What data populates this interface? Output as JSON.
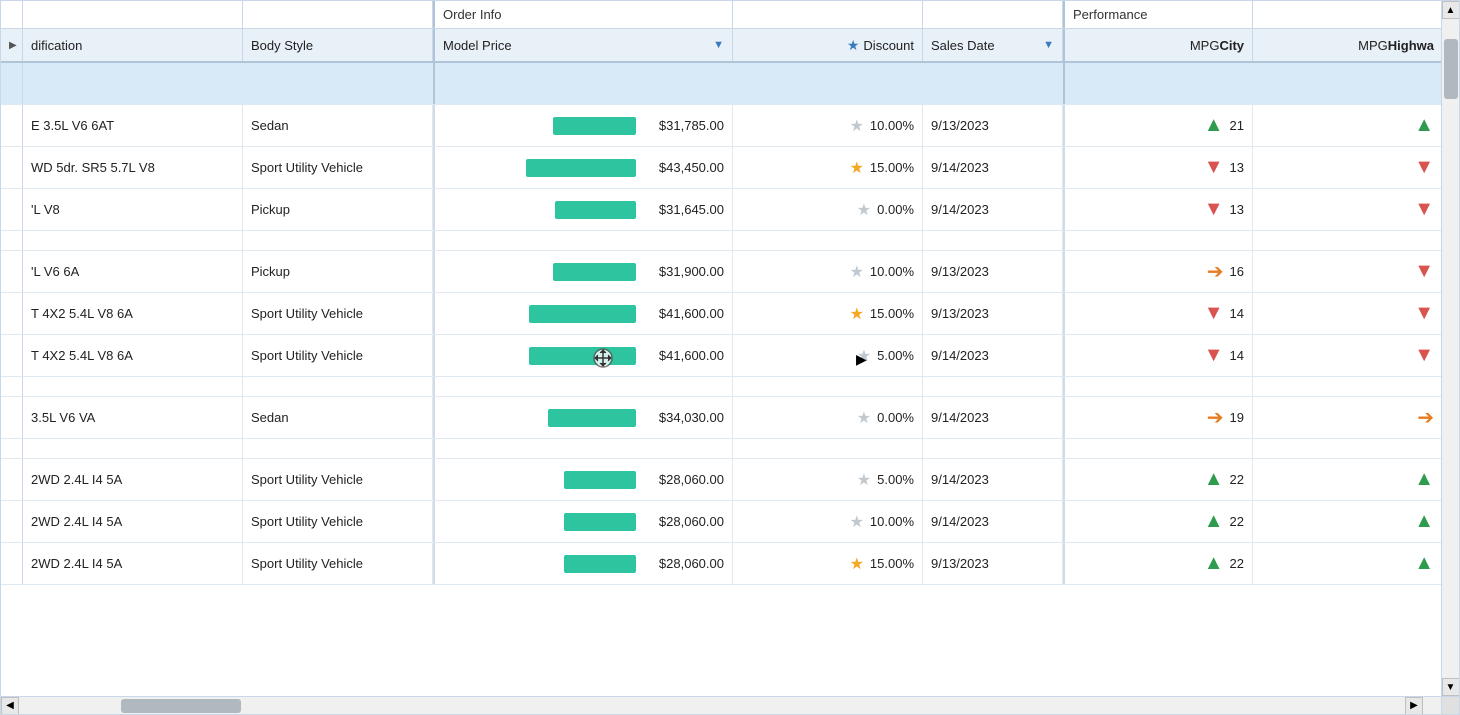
{
  "grid": {
    "group_header": {
      "order_info_label": "Order Info",
      "performance_label": "Performance"
    },
    "columns": [
      {
        "id": "expand",
        "label": ""
      },
      {
        "id": "modification",
        "label": "dification"
      },
      {
        "id": "body_style",
        "label": "Body Style"
      },
      {
        "id": "model_price",
        "label": "Model Price",
        "has_filter": true
      },
      {
        "id": "discount",
        "label": "Discount",
        "has_star": true
      },
      {
        "id": "sales_date",
        "label": "Sales Date",
        "has_filter": true
      },
      {
        "id": "mpg_city",
        "label_prefix": "MPG ",
        "label_bold": "City"
      },
      {
        "id": "mpg_highway",
        "label_prefix": "MPG ",
        "label_bold": "Highwa"
      }
    ],
    "rows": [
      {
        "type": "highlighted",
        "modification": "",
        "body_style": "",
        "price_bar_width": 0,
        "price": "",
        "star_filled": false,
        "discount": "",
        "sales_date": "",
        "mpg_city_arrow": "",
        "mpg_city": "",
        "mpg_highway_arrow": ""
      },
      {
        "type": "data",
        "modification": "E 3.5L V6 6AT",
        "body_style": "Sedan",
        "price_bar_width": 75,
        "price": "$31,785.00",
        "star_filled": false,
        "discount": "10.00%",
        "sales_date": "9/13/2023",
        "mpg_city_arrow": "up-green",
        "mpg_city": "21",
        "mpg_highway_arrow": "up-green"
      },
      {
        "type": "data",
        "modification": "WD 5dr. SR5 5.7L V8",
        "body_style": "Sport Utility Vehicle",
        "price_bar_width": 100,
        "price": "$43,450.00",
        "star_filled": true,
        "discount": "15.00%",
        "sales_date": "9/14/2023",
        "mpg_city_arrow": "down-red",
        "mpg_city": "13",
        "mpg_highway_arrow": "down-red"
      },
      {
        "type": "data",
        "modification": "'L V8",
        "body_style": "Pickup",
        "price_bar_width": 74,
        "price": "$31,645.00",
        "star_filled": false,
        "discount": "0.00%",
        "sales_date": "9/14/2023",
        "mpg_city_arrow": "down-red",
        "mpg_city": "13",
        "mpg_highway_arrow": "down-red"
      },
      {
        "type": "spacer"
      },
      {
        "type": "data",
        "modification": "'L V6 6A",
        "body_style": "Pickup",
        "price_bar_width": 75,
        "price": "$31,900.00",
        "star_filled": false,
        "discount": "10.00%",
        "sales_date": "9/13/2023",
        "mpg_city_arrow": "right-orange",
        "mpg_city": "16",
        "mpg_highway_arrow": "down-red"
      },
      {
        "type": "data",
        "modification": "T 4X2 5.4L V8 6A",
        "body_style": "Sport Utility Vehicle",
        "price_bar_width": 97,
        "price": "$41,600.00",
        "star_filled": true,
        "discount": "15.00%",
        "sales_date": "9/13/2023",
        "mpg_city_arrow": "down-red",
        "mpg_city": "14",
        "mpg_highway_arrow": "down-red"
      },
      {
        "type": "data",
        "modification": "T 4X2 5.4L V8 6A",
        "body_style": "Sport Utility Vehicle",
        "price_bar_width": 97,
        "price": "$41,600.00",
        "star_filled": false,
        "discount": "5.00%",
        "sales_date": "9/14/2023",
        "mpg_city_arrow": "down-red",
        "mpg_city": "14",
        "mpg_highway_arrow": "down-red"
      },
      {
        "type": "spacer"
      },
      {
        "type": "data",
        "modification": "3.5L V6 VA",
        "body_style": "Sedan",
        "price_bar_width": 80,
        "price": "$34,030.00",
        "star_filled": false,
        "discount": "0.00%",
        "sales_date": "9/14/2023",
        "mpg_city_arrow": "right-orange",
        "mpg_city": "19",
        "mpg_highway_arrow": "right-orange"
      },
      {
        "type": "spacer"
      },
      {
        "type": "data",
        "modification": "2WD 2.4L I4 5A",
        "body_style": "Sport Utility Vehicle",
        "price_bar_width": 65,
        "price": "$28,060.00",
        "star_filled": false,
        "discount": "5.00%",
        "sales_date": "9/14/2023",
        "mpg_city_arrow": "up-green",
        "mpg_city": "22",
        "mpg_highway_arrow": "up-green"
      },
      {
        "type": "data",
        "modification": "2WD 2.4L I4 5A",
        "body_style": "Sport Utility Vehicle",
        "price_bar_width": 65,
        "price": "$28,060.00",
        "star_filled": false,
        "discount": "10.00%",
        "sales_date": "9/14/2023",
        "mpg_city_arrow": "up-green",
        "mpg_city": "22",
        "mpg_highway_arrow": "up-green"
      },
      {
        "type": "data",
        "modification": "2WD 2.4L I4 5A",
        "body_style": "Sport Utility Vehicle",
        "price_bar_width": 65,
        "price": "$28,060.00",
        "star_filled": true,
        "discount": "15.00%",
        "sales_date": "9/13/2023",
        "mpg_city_arrow": "up-green",
        "mpg_city": "22",
        "mpg_highway_arrow": "up-green"
      }
    ]
  }
}
